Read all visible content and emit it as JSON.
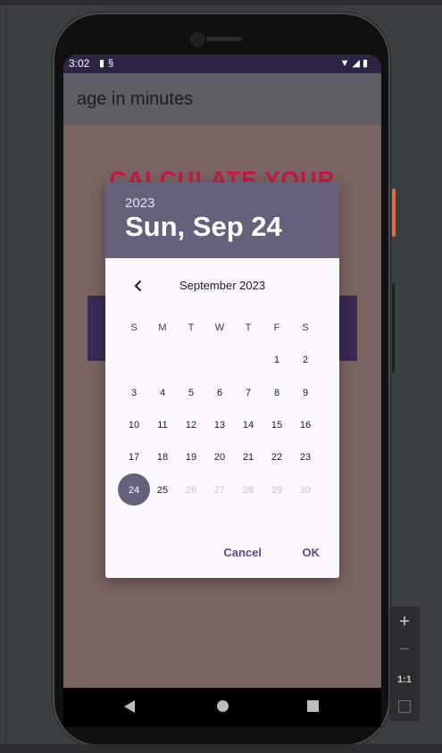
{
  "status_bar": {
    "time": "3:02",
    "left_icons": [
      "sim-icon",
      "sync-icon"
    ],
    "right_icons": [
      "wifi-icon",
      "signal-icon",
      "battery-icon"
    ]
  },
  "app_bar": {
    "title": "age in minutes"
  },
  "background": {
    "heading": "CALCULATE YOUR"
  },
  "dialog": {
    "year": "2023",
    "selected_date": "Sun, Sep 24",
    "month_label": "September 2023",
    "weekdays": [
      "S",
      "M",
      "T",
      "W",
      "T",
      "F",
      "S"
    ],
    "weeks": [
      [
        "",
        "",
        "",
        "",
        "",
        "1",
        "2"
      ],
      [
        "3",
        "4",
        "5",
        "6",
        "7",
        "8",
        "9"
      ],
      [
        "10",
        "11",
        "12",
        "13",
        "14",
        "15",
        "16"
      ],
      [
        "17",
        "18",
        "19",
        "20",
        "21",
        "22",
        "23"
      ],
      [
        "24",
        "25",
        "26",
        "27",
        "28",
        "29",
        "30"
      ]
    ],
    "selected_day": "24",
    "disabled_days": [
      "26",
      "27",
      "28",
      "29",
      "30"
    ],
    "cancel_label": "Cancel",
    "ok_label": "OK"
  },
  "emulator_controls": {
    "zoom_in": "+",
    "zoom_out": "−",
    "actual_size": "1:1"
  },
  "colors": {
    "header": "#67607a",
    "accent": "#5b4b8a",
    "heading": "#c4184a",
    "status_bar": "#2e2446"
  }
}
